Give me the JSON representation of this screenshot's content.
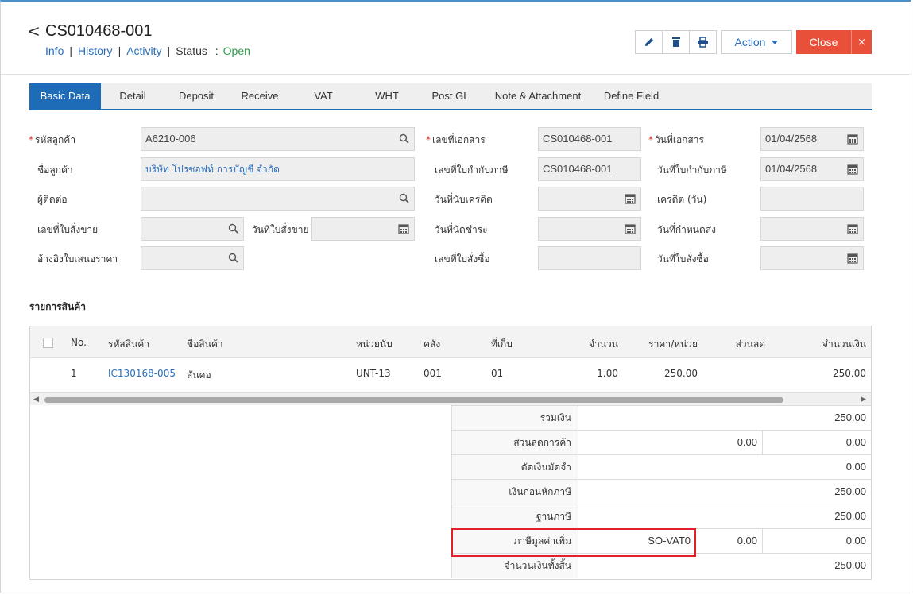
{
  "header": {
    "back_glyph": "<",
    "title": "CS010468-001",
    "links": {
      "info": "Info",
      "history": "History",
      "activity": "Activity"
    },
    "separator": "|",
    "status_label": "Status",
    "status_colon": ":",
    "status_value": "Open",
    "action_label": "Action",
    "close_label": "Close",
    "close_x": "×",
    "icons": [
      "pencil-icon",
      "trash-icon",
      "printer-icon"
    ]
  },
  "tabs": [
    "Basic Data",
    "Detail",
    "Deposit",
    "Receive",
    "VAT",
    "WHT",
    "Post GL",
    "Note & Attachment",
    "Define Field"
  ],
  "form": {
    "req": "*",
    "customer_code_label": "รหัสลูกค้า",
    "customer_code": "A6210-006",
    "customer_name_label": "ชื่อลูกค้า",
    "customer_name": "บริษัท โปรซอฟท์ การบัญชี จำกัด",
    "contact_label": "ผู้ติดต่อ",
    "contact": "",
    "so_no_label": "เลขที่ใบสั่งขาย",
    "so_no": "",
    "so_date_label": "วันที่ใบสั่งขาย",
    "so_date": "",
    "quotation_ref_label": "อ้างอิงใบเสนอราคา",
    "quotation_ref": "",
    "doc_no_label": "เลขที่เอกสาร",
    "doc_no": "CS010468-001",
    "tax_invoice_no_label": "เลขที่ใบกำกับภาษี",
    "tax_invoice_no": "CS010468-001",
    "credit_count_date_label": "วันที่นับเครดิต",
    "credit_count_date": "",
    "due_date_label": "วันที่นัดชำระ",
    "due_date": "",
    "po_no_label": "เลขที่ใบสั่งซื้อ",
    "po_no": "",
    "doc_date_label": "วันที่เอกสาร",
    "doc_date": "01/04/2568",
    "tax_invoice_date_label": "วันที่ใบกำกับภาษี",
    "tax_invoice_date": "01/04/2568",
    "credit_days_label": "เครดิต (วัน)",
    "credit_days": "",
    "delivery_date_label": "วันที่กำหนดส่ง",
    "delivery_date": "",
    "po_date_label": "วันที่ใบสั่งซื้อ",
    "po_date": ""
  },
  "items": {
    "section_title": "รายการสินค้า",
    "columns": [
      "No.",
      "รหัสสินค้า",
      "ชื่อสินค้า",
      "หน่วยนับ",
      "คลัง",
      "ที่เก็บ",
      "จำนวน",
      "ราคา/หน่วย",
      "ส่วนลด",
      "จำนวนเงิน"
    ],
    "rows": [
      {
        "no": "1",
        "code": "IC130168-005",
        "name": "สันคอ",
        "unit": "UNT-13",
        "warehouse": "001",
        "location": "01",
        "qty": "1.00",
        "price": "250.00",
        "discount": "",
        "amount": "250.00"
      }
    ]
  },
  "totals": {
    "subtotal_label": "รวมเงิน",
    "subtotal": "250.00",
    "trade_discount_label": "ส่วนลดการค้า",
    "trade_discount_1": "0.00",
    "trade_discount_2": "0.00",
    "deposit_label": "ตัดเงินมัดจำ",
    "deposit": "0.00",
    "before_tax_label": "เงินก่อนหักภาษี",
    "before_tax": "250.00",
    "tax_base_label": "ฐานภาษี",
    "tax_base": "250.00",
    "vat_label": "ภาษีมูลค่าเพิ่ม",
    "vat_code": "SO-VAT0",
    "vat_rate": "0.00",
    "vat_amount": "0.00",
    "grand_total_label": "จำนวนเงินทั้งสิ้น",
    "grand_total": "250.00"
  },
  "colors": {
    "accent": "#1e6bb8",
    "close": "#e8503a",
    "status_open": "#2e9a4a",
    "highlight": "#e0202a"
  }
}
